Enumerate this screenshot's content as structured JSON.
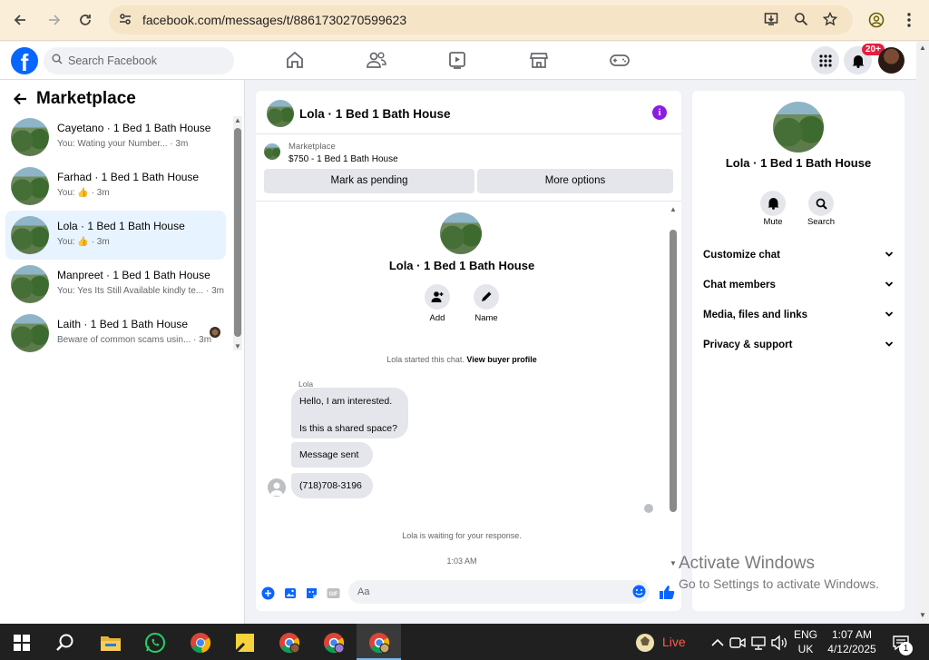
{
  "browser": {
    "url": "facebook.com/messages/t/8861730270599623"
  },
  "fb": {
    "logo": "f",
    "search_placeholder": "Search Facebook",
    "notification_badge": "20+"
  },
  "sidebar": {
    "title": "Marketplace",
    "conversations": [
      {
        "name": "Cayetano · 1 Bed 1 Bath House",
        "preview": "You: Wating your Number... · 3m",
        "active": false
      },
      {
        "name": "Farhad · 1 Bed 1 Bath House",
        "preview": "You: 👍 · 3m",
        "active": false
      },
      {
        "name": "Lola · 1 Bed 1 Bath House",
        "preview": "You: 👍 · 3m",
        "active": true
      },
      {
        "name": "Manpreet · 1 Bed 1 Bath House",
        "preview": "You: Yes Its Still Available kindly te... · 3m",
        "active": false
      },
      {
        "name": "Laith · 1 Bed 1 Bath House",
        "preview": "Beware of common scams usin... · 3m",
        "active": false
      }
    ]
  },
  "chat": {
    "header_title": "Lola · 1 Bed 1 Bath House",
    "listing_source": "Marketplace",
    "listing_price": "$750 - 1 Bed 1 Bath House",
    "mark_pending_label": "Mark as pending",
    "more_options_label": "More options",
    "profile_title": "Lola · 1 Bed 1 Bath House",
    "add_label": "Add",
    "name_label": "Name",
    "started_text": "Lola started this chat.",
    "view_profile_link": "View buyer profile",
    "sender_name": "Lola",
    "messages": [
      "Hello, I am interested.",
      "Is this a shared space?",
      "Message sent",
      "(718)708-3196"
    ],
    "waiting_text": "Lola is waiting for your response.",
    "time_stamp": "1:03 AM",
    "composer_placeholder": "Aa"
  },
  "details": {
    "title": "Lola · 1 Bed 1 Bath House",
    "mute_label": "Mute",
    "search_label": "Search",
    "sections": [
      "Customize chat",
      "Chat members",
      "Media, files and links",
      "Privacy & support"
    ]
  },
  "watermark": {
    "line1": "Activate Windows",
    "line2": "Go to Settings to activate Windows."
  },
  "taskbar": {
    "live_label": "Live",
    "lang_top": "ENG",
    "lang_bottom": "UK",
    "time": "1:07 AM",
    "date": "4/12/2025",
    "notif_count": "1"
  },
  "colors": {
    "fb_blue": "#0866ff",
    "active_convo": "#e7f3ff",
    "info_purple": "#8a1ee0",
    "badge_red": "#e41e3f"
  }
}
